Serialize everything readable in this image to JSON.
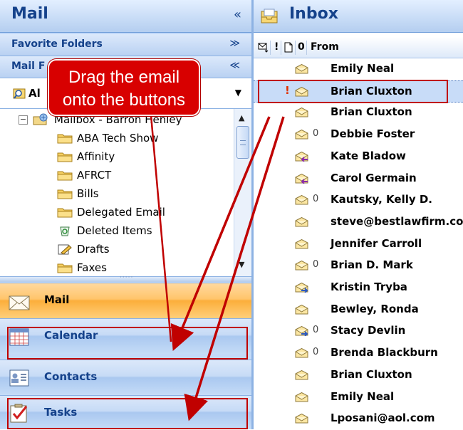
{
  "left_pane": {
    "title": "Mail",
    "collapse_glyph": "«",
    "favorite_folders": {
      "label": "Favorite Folders",
      "chevron": "≫"
    },
    "mail_folders": {
      "label": "Mail F",
      "chevron": "≪"
    },
    "folder_selector": {
      "text": "Al",
      "dropdown": "▼"
    },
    "mailbox": {
      "expander": "⊟",
      "label": "Mailbox - Barron Henley"
    },
    "folders": [
      {
        "label": "ABA Tech Show",
        "icon": "folder-icon"
      },
      {
        "label": "Affinity",
        "icon": "folder-icon"
      },
      {
        "label": "AFRCT",
        "icon": "folder-icon"
      },
      {
        "label": "Bills",
        "icon": "folder-icon"
      },
      {
        "label": "Delegated Email",
        "icon": "folder-icon"
      },
      {
        "label": "Deleted Items",
        "icon": "recycle-bin-icon"
      },
      {
        "label": "Drafts",
        "icon": "drafts-icon"
      },
      {
        "label": "Faxes",
        "icon": "folder-icon"
      }
    ],
    "splitter_dots": "·····",
    "nav_buttons": [
      {
        "label": "Mail",
        "icon": "mail-icon",
        "active": true
      },
      {
        "label": "Calendar",
        "icon": "calendar-icon",
        "active": false
      },
      {
        "label": "Contacts",
        "icon": "contacts-icon",
        "active": false
      },
      {
        "label": "Tasks",
        "icon": "tasks-icon",
        "active": false
      }
    ]
  },
  "inbox": {
    "title": "Inbox",
    "columns": {
      "from": "From",
      "importance": "!",
      "attachment": "0"
    },
    "messages": [
      {
        "from": "Emily Neal",
        "attachment": false,
        "important": false,
        "icon": "envelope-open-icon"
      },
      {
        "from": "Brian Cluxton",
        "attachment": false,
        "important": true,
        "icon": "envelope-open-icon",
        "selected": true
      },
      {
        "from": "Brian Cluxton",
        "attachment": false,
        "important": false,
        "icon": "envelope-open-icon"
      },
      {
        "from": "Debbie Foster",
        "attachment": true,
        "important": false,
        "icon": "envelope-open-icon"
      },
      {
        "from": "Kate Bladow",
        "attachment": false,
        "important": false,
        "icon": "envelope-replied-icon"
      },
      {
        "from": "Carol Germain",
        "attachment": false,
        "important": false,
        "icon": "envelope-replied-icon"
      },
      {
        "from": "Kautsky, Kelly D.",
        "attachment": true,
        "important": false,
        "icon": "envelope-open-icon"
      },
      {
        "from": "steve@bestlawfirm.com",
        "attachment": false,
        "important": false,
        "icon": "envelope-open-icon"
      },
      {
        "from": "Jennifer Carroll",
        "attachment": false,
        "important": false,
        "icon": "envelope-open-icon"
      },
      {
        "from": "Brian D. Mark",
        "attachment": true,
        "important": false,
        "icon": "envelope-open-icon"
      },
      {
        "from": "Kristin Tryba",
        "attachment": false,
        "important": false,
        "icon": "envelope-forwarded-icon"
      },
      {
        "from": "Bewley, Ronda",
        "attachment": false,
        "important": false,
        "icon": "envelope-open-icon"
      },
      {
        "from": "Stacy Devlin",
        "attachment": true,
        "important": false,
        "icon": "envelope-forwarded-icon"
      },
      {
        "from": "Brenda Blackburn",
        "attachment": true,
        "important": false,
        "icon": "envelope-open-icon"
      },
      {
        "from": "Brian Cluxton",
        "attachment": false,
        "important": false,
        "icon": "envelope-open-icon"
      },
      {
        "from": "Emily Neal",
        "attachment": false,
        "important": false,
        "icon": "envelope-open-icon"
      },
      {
        "from": "Lposani@aol.com",
        "attachment": false,
        "important": false,
        "icon": "envelope-open-icon"
      }
    ]
  },
  "callout": {
    "line1": "Drag the email",
    "line2": "onto the buttons"
  },
  "colors": {
    "accent": "#c00000",
    "header_text": "#15428b",
    "nav_active": "#fcae3b",
    "pane_bg": "#c3daf9"
  }
}
